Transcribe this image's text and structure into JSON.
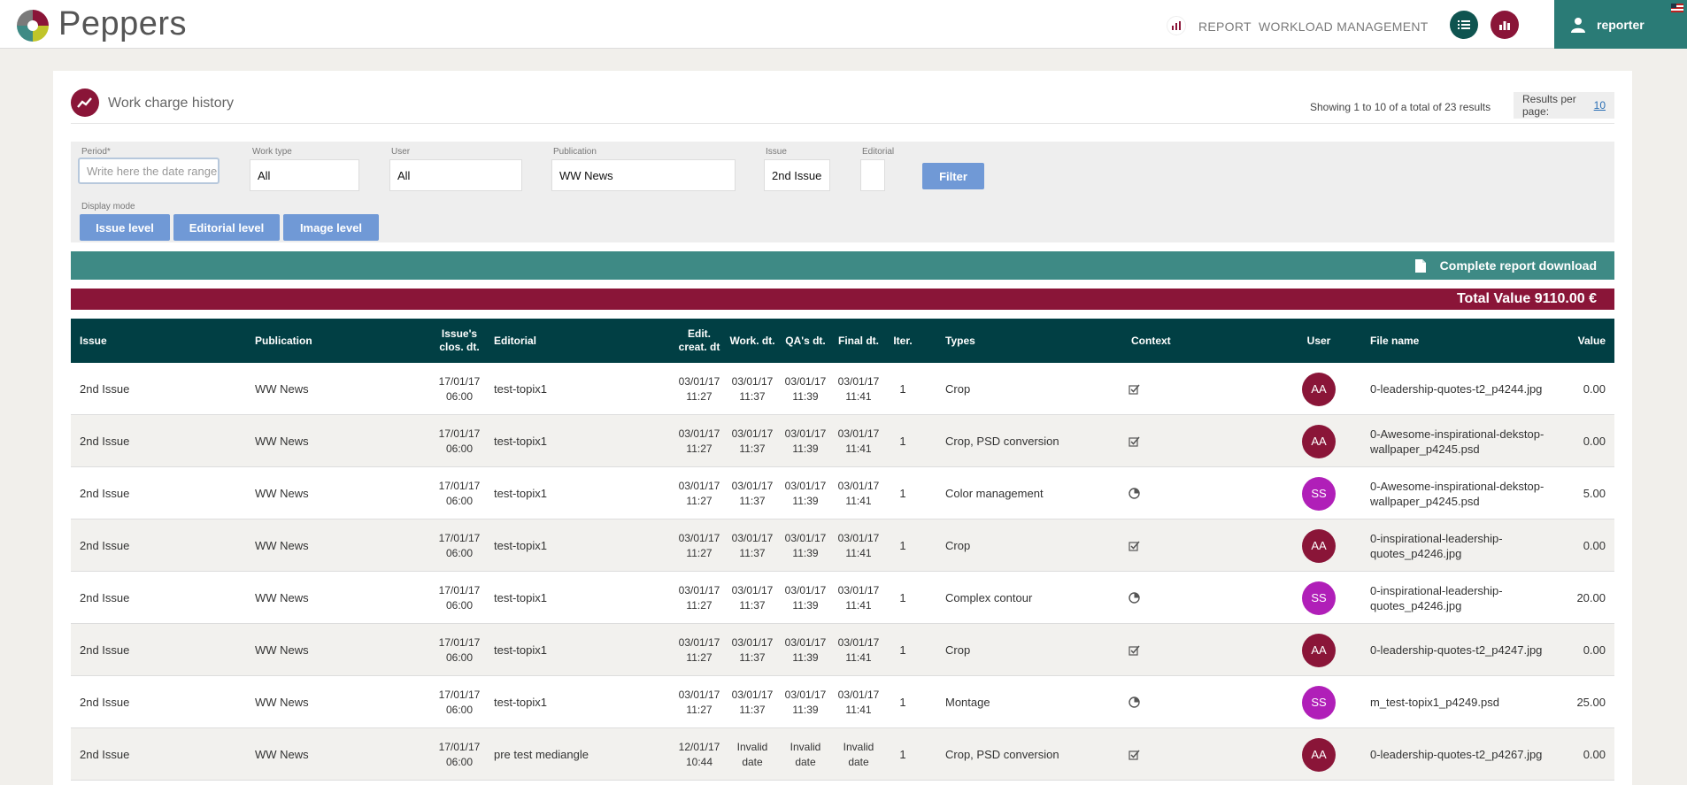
{
  "header": {
    "brand": "Peppers",
    "nav": [
      "REPORT",
      "WORKLOAD MANAGEMENT"
    ],
    "username": "reporter",
    "colors": {
      "teal": "#2a7b76",
      "crimson": "#8a1538",
      "dark": "#0f5450"
    }
  },
  "panel": {
    "title": "Work charge history",
    "showing": "Showing 1 to 10 of a total of 23 results",
    "results_per_page_label": "Results per page:",
    "results_per_page_value": "10"
  },
  "filters": {
    "period_label": "Period*",
    "period_placeholder": "Write here the date range",
    "work_type_label": "Work type",
    "work_type_value": "All",
    "user_label": "User",
    "user_value": "All",
    "publication_label": "Publication",
    "publication_value": "WW News",
    "issue_label": "Issue",
    "issue_value": "2nd Issue",
    "editorial_label": "Editorial",
    "editorial_value": "",
    "filter_button": "Filter",
    "display_mode_label": "Display mode",
    "display_modes": [
      "Issue level",
      "Editorial level",
      "Image level"
    ]
  },
  "download_label": "Complete report download",
  "total_label": "Total Value 9110.00 €",
  "table": {
    "headers": {
      "issue": "Issue",
      "publication": "Publication",
      "closing": "Issue's clos. dt.",
      "editorial": "Editorial",
      "edit_created": "Edit. creat. dt",
      "work": "Work. dt.",
      "qa": "QA's dt.",
      "final": "Final dt.",
      "iter": "Iter.",
      "types": "Types",
      "context": "Context",
      "user": "User",
      "file": "File name",
      "value": "Value"
    },
    "rows": [
      {
        "issue": "2nd Issue",
        "publication": "WW News",
        "closing_d": "17/01/17",
        "closing_t": "06:00",
        "editorial": "test-topix1",
        "ec_d": "03/01/17",
        "ec_t": "11:27",
        "w_d": "03/01/17",
        "w_t": "11:37",
        "q_d": "03/01/17",
        "q_t": "11:39",
        "f_d": "03/01/17",
        "f_t": "11:41",
        "iter": "1",
        "types": "Crop",
        "context": "check-icon",
        "user": "AA",
        "file": "0-leadership-quotes-t2_p4244.jpg",
        "value": "0.00"
      },
      {
        "issue": "2nd Issue",
        "publication": "WW News",
        "closing_d": "17/01/17",
        "closing_t": "06:00",
        "editorial": "test-topix1",
        "ec_d": "03/01/17",
        "ec_t": "11:27",
        "w_d": "03/01/17",
        "w_t": "11:37",
        "q_d": "03/01/17",
        "q_t": "11:39",
        "f_d": "03/01/17",
        "f_t": "11:41",
        "iter": "1",
        "types": "Crop, PSD conversion",
        "context": "check-icon",
        "user": "AA",
        "file": "0-Awesome-inspirational-dekstop-wallpaper_p4245.psd",
        "value": "0.00"
      },
      {
        "issue": "2nd Issue",
        "publication": "WW News",
        "closing_d": "17/01/17",
        "closing_t": "06:00",
        "editorial": "test-topix1",
        "ec_d": "03/01/17",
        "ec_t": "11:27",
        "w_d": "03/01/17",
        "w_t": "11:37",
        "q_d": "03/01/17",
        "q_t": "11:39",
        "f_d": "03/01/17",
        "f_t": "11:41",
        "iter": "1",
        "types": "Color management",
        "context": "clock-icon",
        "user": "SS",
        "file": "0-Awesome-inspirational-dekstop-wallpaper_p4245.psd",
        "value": "5.00"
      },
      {
        "issue": "2nd Issue",
        "publication": "WW News",
        "closing_d": "17/01/17",
        "closing_t": "06:00",
        "editorial": "test-topix1",
        "ec_d": "03/01/17",
        "ec_t": "11:27",
        "w_d": "03/01/17",
        "w_t": "11:37",
        "q_d": "03/01/17",
        "q_t": "11:39",
        "f_d": "03/01/17",
        "f_t": "11:41",
        "iter": "1",
        "types": "Crop",
        "context": "check-icon",
        "user": "AA",
        "file": "0-inspirational-leadership-quotes_p4246.jpg",
        "value": "0.00"
      },
      {
        "issue": "2nd Issue",
        "publication": "WW News",
        "closing_d": "17/01/17",
        "closing_t": "06:00",
        "editorial": "test-topix1",
        "ec_d": "03/01/17",
        "ec_t": "11:27",
        "w_d": "03/01/17",
        "w_t": "11:37",
        "q_d": "03/01/17",
        "q_t": "11:39",
        "f_d": "03/01/17",
        "f_t": "11:41",
        "iter": "1",
        "types": "Complex contour",
        "context": "clock-icon",
        "user": "SS",
        "file": "0-inspirational-leadership-quotes_p4246.jpg",
        "value": "20.00"
      },
      {
        "issue": "2nd Issue",
        "publication": "WW News",
        "closing_d": "17/01/17",
        "closing_t": "06:00",
        "editorial": "test-topix1",
        "ec_d": "03/01/17",
        "ec_t": "11:27",
        "w_d": "03/01/17",
        "w_t": "11:37",
        "q_d": "03/01/17",
        "q_t": "11:39",
        "f_d": "03/01/17",
        "f_t": "11:41",
        "iter": "1",
        "types": "Crop",
        "context": "check-icon",
        "user": "AA",
        "file": "0-leadership-quotes-t2_p4247.jpg",
        "value": "0.00"
      },
      {
        "issue": "2nd Issue",
        "publication": "WW News",
        "closing_d": "17/01/17",
        "closing_t": "06:00",
        "editorial": "test-topix1",
        "ec_d": "03/01/17",
        "ec_t": "11:27",
        "w_d": "03/01/17",
        "w_t": "11:37",
        "q_d": "03/01/17",
        "q_t": "11:39",
        "f_d": "03/01/17",
        "f_t": "11:41",
        "iter": "1",
        "types": "Montage",
        "context": "clock-icon",
        "user": "SS",
        "file": "m_test-topix1_p4249.psd",
        "value": "25.00"
      },
      {
        "issue": "2nd Issue",
        "publication": "WW News",
        "closing_d": "17/01/17",
        "closing_t": "06:00",
        "editorial": "pre test mediangle",
        "ec_d": "12/01/17",
        "ec_t": "10:44",
        "w_d": "Invalid date",
        "w_t": "",
        "q_d": "Invalid date",
        "q_t": "",
        "f_d": "Invalid date",
        "f_t": "",
        "iter": "1",
        "types": "Crop, PSD conversion",
        "context": "check-icon",
        "user": "AA",
        "file": "0-leadership-quotes-t2_p4267.jpg",
        "value": "0.00"
      }
    ],
    "avatar_colors": {
      "AA": "#8a1538",
      "SS": "#b01fb8"
    }
  }
}
